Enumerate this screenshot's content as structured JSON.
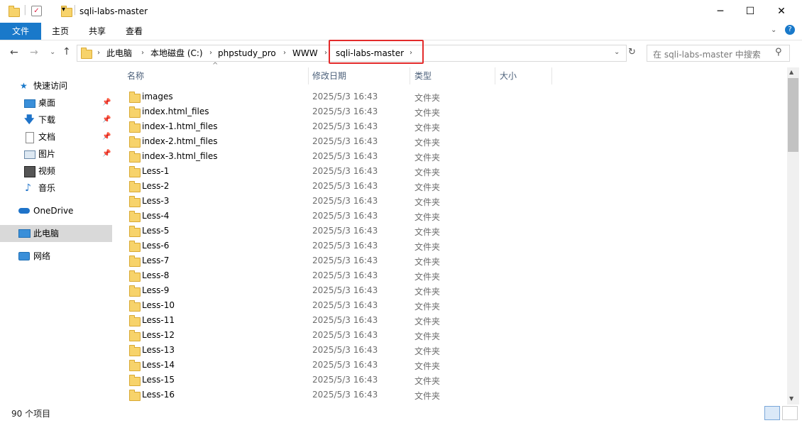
{
  "window": {
    "title": "sqli-labs-master",
    "minimize_glyph": "─",
    "maximize_glyph": "☐",
    "close_glyph": "✕"
  },
  "ribbon": {
    "tabs": [
      "文件",
      "主页",
      "共享",
      "查看"
    ],
    "file_tab_color": "#1979ca"
  },
  "address": {
    "crumbs": [
      "此电脑",
      "本地磁盘 (C:)",
      "phpstudy_pro",
      "WWW",
      "sqli-labs-master"
    ],
    "search_placeholder": "在 sqli-labs-master 中搜索",
    "highlight_color": "#e32b2b"
  },
  "nav": {
    "quick_access": "快速访问",
    "items": [
      {
        "label": "桌面",
        "icon": "desktop-icon",
        "pinned": true
      },
      {
        "label": "下载",
        "icon": "download-icon",
        "pinned": true
      },
      {
        "label": "文档",
        "icon": "document-icon",
        "pinned": true
      },
      {
        "label": "图片",
        "icon": "picture-icon",
        "pinned": true
      },
      {
        "label": "视频",
        "icon": "video-icon",
        "pinned": false
      },
      {
        "label": "音乐",
        "icon": "music-icon",
        "pinned": false
      }
    ],
    "onedrive": "OneDrive",
    "this_pc": "此电脑",
    "network": "网络"
  },
  "columns": {
    "name": "名称",
    "modified": "修改日期",
    "type": "类型",
    "size": "大小"
  },
  "files": [
    {
      "name": "images",
      "date": "2025/5/3 16:43",
      "type": "文件夹"
    },
    {
      "name": "index.html_files",
      "date": "2025/5/3 16:43",
      "type": "文件夹"
    },
    {
      "name": "index-1.html_files",
      "date": "2025/5/3 16:43",
      "type": "文件夹"
    },
    {
      "name": "index-2.html_files",
      "date": "2025/5/3 16:43",
      "type": "文件夹"
    },
    {
      "name": "index-3.html_files",
      "date": "2025/5/3 16:43",
      "type": "文件夹"
    },
    {
      "name": "Less-1",
      "date": "2025/5/3 16:43",
      "type": "文件夹"
    },
    {
      "name": "Less-2",
      "date": "2025/5/3 16:43",
      "type": "文件夹"
    },
    {
      "name": "Less-3",
      "date": "2025/5/3 16:43",
      "type": "文件夹"
    },
    {
      "name": "Less-4",
      "date": "2025/5/3 16:43",
      "type": "文件夹"
    },
    {
      "name": "Less-5",
      "date": "2025/5/3 16:43",
      "type": "文件夹"
    },
    {
      "name": "Less-6",
      "date": "2025/5/3 16:43",
      "type": "文件夹"
    },
    {
      "name": "Less-7",
      "date": "2025/5/3 16:43",
      "type": "文件夹"
    },
    {
      "name": "Less-8",
      "date": "2025/5/3 16:43",
      "type": "文件夹"
    },
    {
      "name": "Less-9",
      "date": "2025/5/3 16:43",
      "type": "文件夹"
    },
    {
      "name": "Less-10",
      "date": "2025/5/3 16:43",
      "type": "文件夹"
    },
    {
      "name": "Less-11",
      "date": "2025/5/3 16:43",
      "type": "文件夹"
    },
    {
      "name": "Less-12",
      "date": "2025/5/3 16:43",
      "type": "文件夹"
    },
    {
      "name": "Less-13",
      "date": "2025/5/3 16:43",
      "type": "文件夹"
    },
    {
      "name": "Less-14",
      "date": "2025/5/3 16:43",
      "type": "文件夹"
    },
    {
      "name": "Less-15",
      "date": "2025/5/3 16:43",
      "type": "文件夹"
    },
    {
      "name": "Less-16",
      "date": "2025/5/3 16:43",
      "type": "文件夹"
    }
  ],
  "status": {
    "item_count": "90 个项目"
  }
}
